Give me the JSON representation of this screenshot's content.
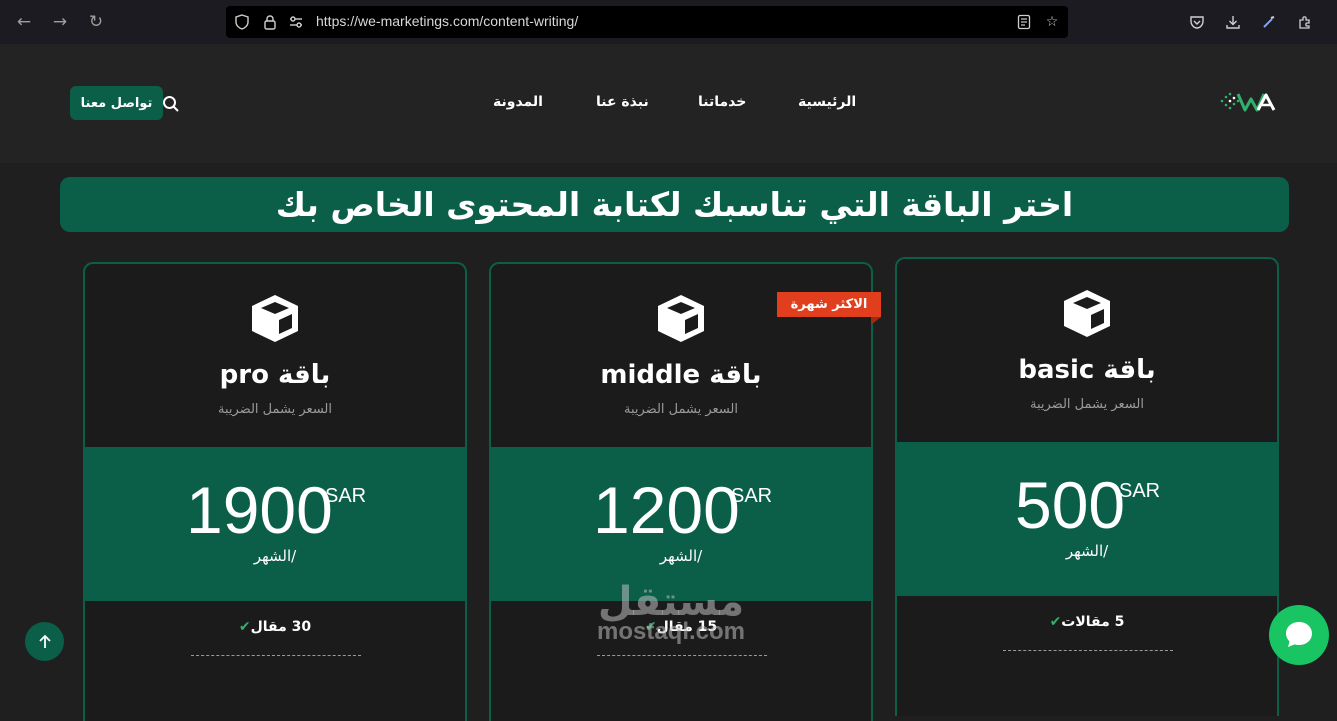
{
  "browser": {
    "url": "https://we-marketings.com/content-writing/"
  },
  "header": {
    "contact_label": "تواصل معنا",
    "nav": [
      {
        "label": "الرئيسية"
      },
      {
        "label": "خدماتنا"
      },
      {
        "label": "نبذة عنا"
      },
      {
        "label": "المدونة"
      }
    ]
  },
  "banner": {
    "title": "اختر الباقة التي تناسبك لكتابة المحتوى الخاص بك"
  },
  "badge": {
    "label": "الاكثر شهرة"
  },
  "cards": [
    {
      "title": "باقة pro",
      "subtitle": "السعر يشمل الضريبة",
      "price": "1900",
      "currency": "SAR",
      "period": "/الشهر",
      "feature": "30 مقال"
    },
    {
      "title": "باقة middle",
      "subtitle": "السعر يشمل الضريبة",
      "price": "1200",
      "currency": "SAR",
      "period": "/الشهر",
      "feature": "15 مقال"
    },
    {
      "title": "باقة basic",
      "subtitle": "السعر يشمل الضريبة",
      "price": "500",
      "currency": "SAR",
      "period": "/الشهر",
      "feature": "5 مقالات"
    }
  ],
  "watermark": {
    "arabic": "مستقل",
    "latin": "mostaql.com"
  },
  "colors": {
    "brand_green": "#0b5f49",
    "badge_red": "#e03e1d",
    "check_green": "#2fb16c",
    "chat_green": "#19c463"
  }
}
